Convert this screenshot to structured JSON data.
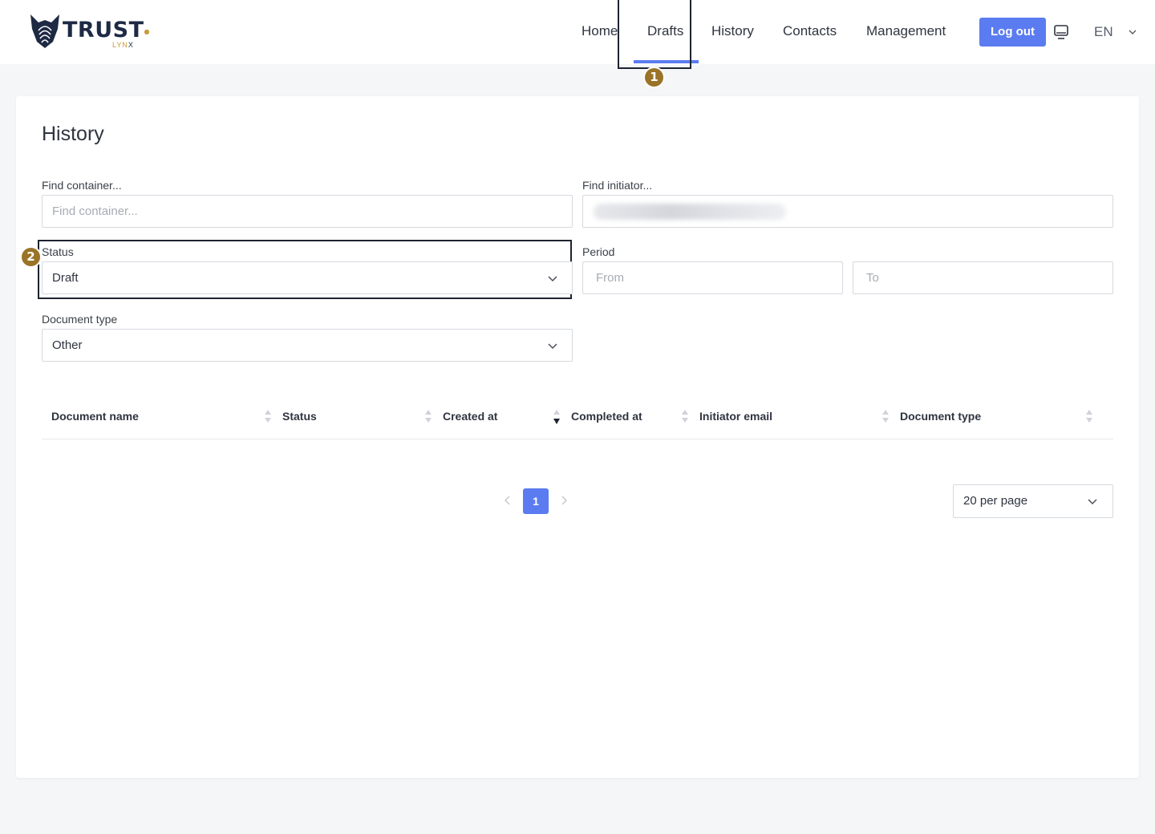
{
  "brand": {
    "name": "TRUST",
    "sub_prefix": "LYN",
    "sub_suffix": "X"
  },
  "nav": {
    "home": "Home",
    "drafts": "Drafts",
    "history": "History",
    "contacts": "Contacts",
    "management": "Management",
    "logout": "Log out",
    "language": "EN"
  },
  "annotations": {
    "step1": "1",
    "step2": "2"
  },
  "page": {
    "title": "History"
  },
  "filters": {
    "container_label": "Find container...",
    "container_placeholder": "Find container...",
    "initiator_label": "Find initiator...",
    "status_label": "Status",
    "status_value": "Draft",
    "period_label": "Period",
    "period_from_placeholder": "From",
    "period_to_placeholder": "To",
    "doctype_label": "Document type",
    "doctype_value": "Other"
  },
  "table": {
    "columns": [
      "Document name",
      "Status",
      "Created at",
      "Completed at",
      "Initiator email",
      "Document type"
    ],
    "sorted_column": "Created at",
    "sort_direction": "desc"
  },
  "pagination": {
    "current_page": "1",
    "per_page": "20 per page"
  },
  "colors": {
    "accent": "#5b7cf0",
    "badge": "#9a7328",
    "brand_dark": "#1e2a44"
  }
}
